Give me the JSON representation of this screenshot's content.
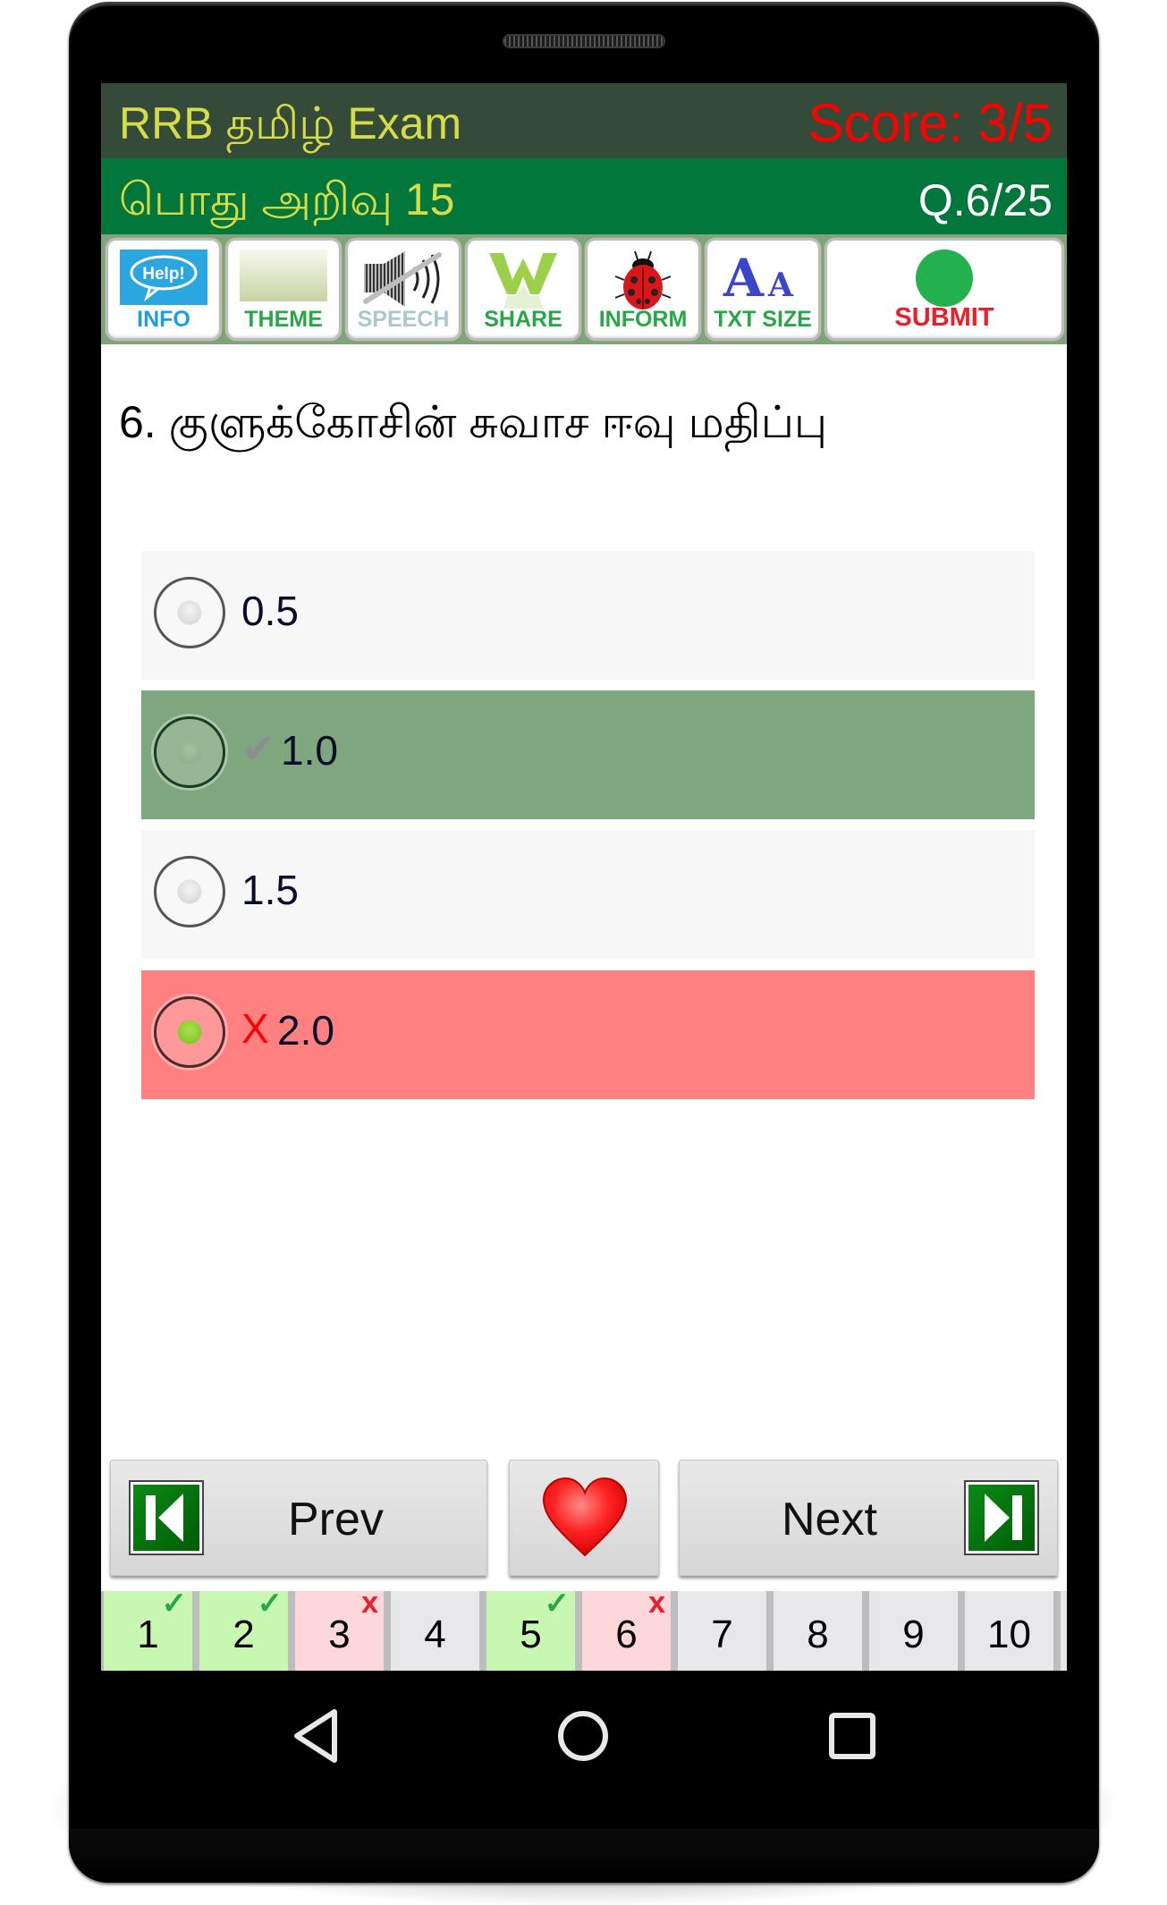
{
  "app": {
    "title": "RRB தமிழ் Exam",
    "score": "Score: 3/5",
    "subtitle": "பொது அறிவு 15",
    "question_counter": "Q.6/25"
  },
  "toolbar": [
    {
      "label": "INFO",
      "icon": "help-bubble-icon",
      "color": "#1a9ee0"
    },
    {
      "label": "THEME",
      "icon": "theme-gradient-icon",
      "color": "#27a844"
    },
    {
      "label": "SPEECH",
      "icon": "speaker-muted-icon",
      "color": "#a9c9cf"
    },
    {
      "label": "SHARE",
      "icon": "share-w-icon",
      "color": "#27a844"
    },
    {
      "label": "INFORM",
      "icon": "ladybug-icon",
      "color": "#27a844"
    },
    {
      "label": "TXT SIZE",
      "icon": "text-size-icon",
      "color": "#27a844"
    },
    {
      "label": "SUBMIT",
      "icon": "green-dot-icon",
      "color": "#e8202a"
    }
  ],
  "question": {
    "text": "6. குளுக்கோசின் சுவாச ஈவு மதிப்பு"
  },
  "options": [
    {
      "text": "0.5",
      "mark": "",
      "state": "neutral",
      "selected": false,
      "bg": "#f7f7f7"
    },
    {
      "text": "1.0",
      "mark": "✔",
      "state": "correct",
      "selected": false,
      "bg": "#7fa77f"
    },
    {
      "text": "1.5",
      "mark": "",
      "state": "neutral",
      "selected": false,
      "bg": "#f7f7f7"
    },
    {
      "text": "2.0",
      "mark": "X",
      "state": "wrong",
      "selected": true,
      "bg": "#ff8080"
    }
  ],
  "navigation": {
    "prev_label": "Prev",
    "next_label": "Next",
    "favorite_icon": "heart-icon"
  },
  "question_strip": [
    {
      "n": "1",
      "status": "correct"
    },
    {
      "n": "2",
      "status": "correct"
    },
    {
      "n": "3",
      "status": "wrong"
    },
    {
      "n": "4",
      "status": "unanswered"
    },
    {
      "n": "5",
      "status": "correct"
    },
    {
      "n": "6",
      "status": "wrong"
    },
    {
      "n": "7",
      "status": "unanswered"
    },
    {
      "n": "8",
      "status": "unanswered"
    },
    {
      "n": "9",
      "status": "unanswered"
    },
    {
      "n": "10",
      "status": "unanswered"
    }
  ],
  "status_marks": {
    "correct": "✓",
    "wrong": "x"
  },
  "status_colors": {
    "correct": "#c7f7b0",
    "wrong": "#fdd7da",
    "unanswered": "#e8e7e9"
  },
  "android_nav": [
    "back-icon",
    "home-icon",
    "recents-icon"
  ]
}
